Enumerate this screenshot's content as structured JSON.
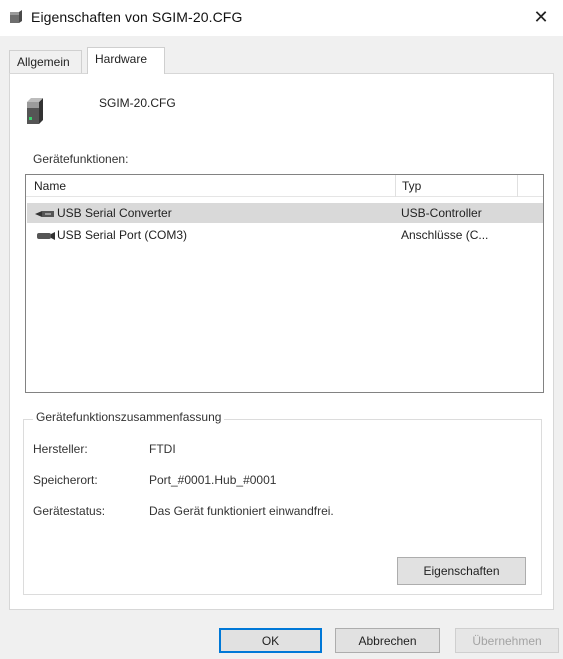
{
  "window": {
    "title": "Eigenschaften von SGIM-20.CFG",
    "icon": "drive-icon",
    "close_glyph": "✕"
  },
  "tabs": [
    {
      "label": "Allgemein",
      "active": false
    },
    {
      "label": "Hardware",
      "active": true
    }
  ],
  "device": {
    "name": "SGIM-20.CFG",
    "icon": "drive-icon"
  },
  "functions": {
    "label": "Gerätefunktionen:",
    "columns": {
      "name": "Name",
      "type": "Typ"
    },
    "rows": [
      {
        "name": "USB Serial Converter",
        "type": "USB-Controller",
        "icon": "usb-connector-icon",
        "selected": true
      },
      {
        "name": "USB Serial Port (COM3)",
        "type": "Anschlüsse (C...",
        "icon": "serial-port-icon",
        "selected": false
      }
    ]
  },
  "summary": {
    "legend": "Gerätefunktionszusammenfassung",
    "manufacturer_label": "Hersteller:",
    "manufacturer_value": "FTDI",
    "location_label": "Speicherort:",
    "location_value": "Port_#0001.Hub_#0001",
    "status_label": "Gerätestatus:",
    "status_value": "Das Gerät funktioniert einwandfrei.",
    "properties_button": "Eigenschaften"
  },
  "buttons": {
    "ok": "OK",
    "cancel": "Abbrechen",
    "apply": "Übernehmen"
  },
  "colors": {
    "dialog_bg": "#f0f0f0",
    "selection_bg": "#d9d9d9",
    "default_button_border": "#0078d7",
    "disabled_text": "#a3a3a3"
  }
}
